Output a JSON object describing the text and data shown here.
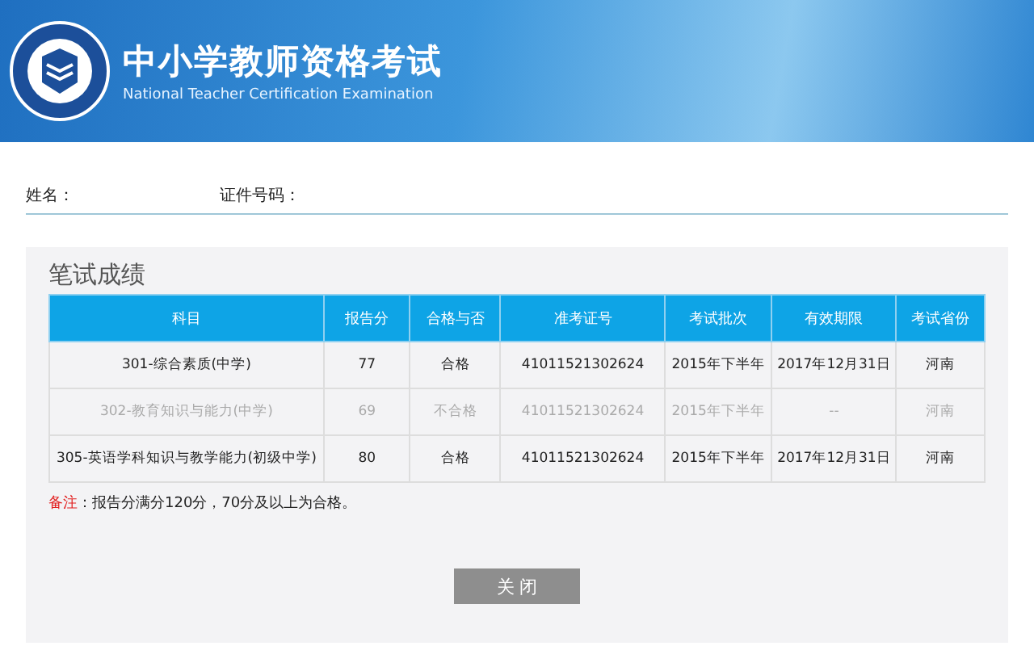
{
  "header": {
    "title": "中小学教师资格考试",
    "subtitle": "National Teacher Certification Examination"
  },
  "info": [
    {
      "label": "姓名："
    },
    {
      "label": "证件号码："
    }
  ],
  "panel": {
    "title": "笔试成绩"
  },
  "table": {
    "columns": [
      "科目",
      "报告分",
      "合格与否",
      "准考证号",
      "考试批次",
      "有效期限",
      "考试省份"
    ],
    "rows": [
      {
        "passed": true,
        "cells": [
          "301-综合素质(中学)",
          "77",
          "合格",
          "41011521302624",
          "2015年下半年",
          "2017年12月31日",
          "河南"
        ]
      },
      {
        "passed": false,
        "cells": [
          "302-教育知识与能力(中学)",
          "69",
          "不合格",
          "41011521302624",
          "2015年下半年",
          "--",
          "河南"
        ]
      },
      {
        "passed": true,
        "cells": [
          "305-英语学科知识与教学能力(初级中学)",
          "80",
          "合格",
          "41011521302624",
          "2015年下半年",
          "2017年12月31日",
          "河南"
        ]
      }
    ]
  },
  "note": {
    "label": "备注",
    "text": "：报告分满分120分，70分及以上为合格。"
  },
  "buttons": [
    "关 闭"
  ]
}
